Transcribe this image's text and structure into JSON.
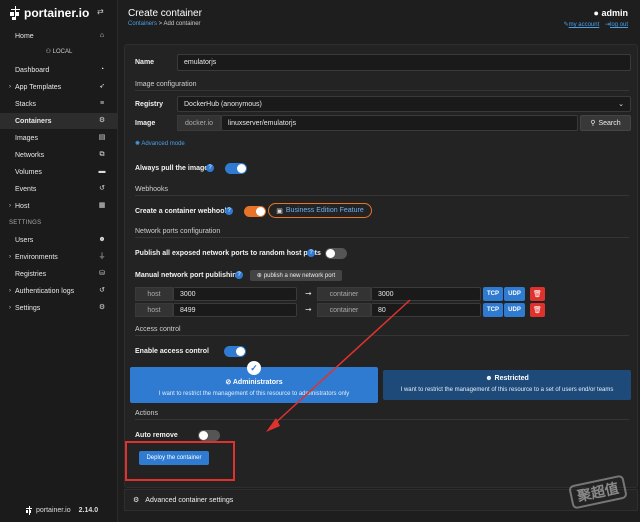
{
  "sidebar": {
    "brand": "portainer.io",
    "items": [
      {
        "label": "Home",
        "icon": "home-icon"
      },
      {
        "label": "Dashboard",
        "icon": "dashboard-icon"
      },
      {
        "label": "App Templates",
        "icon": "rocket-icon"
      },
      {
        "label": "Stacks",
        "icon": "stack-icon"
      },
      {
        "label": "Containers",
        "icon": "containers-icon"
      },
      {
        "label": "Images",
        "icon": "images-icon"
      },
      {
        "label": "Networks",
        "icon": "network-icon"
      },
      {
        "label": "Volumes",
        "icon": "volume-icon"
      },
      {
        "label": "Events",
        "icon": "history-icon"
      },
      {
        "label": "Host",
        "icon": "grid-icon"
      },
      {
        "label": "Users",
        "icon": "users-icon"
      },
      {
        "label": "Environments",
        "icon": "plug-icon"
      },
      {
        "label": "Registries",
        "icon": "database-icon"
      },
      {
        "label": "Authentication logs",
        "icon": "history-icon"
      },
      {
        "label": "Settings",
        "icon": "cogs-icon"
      }
    ],
    "env_label": "LOCAL",
    "settings_heading": "SETTINGS",
    "footer_brand": "portainer.io",
    "version": "2.14.0"
  },
  "header": {
    "title": "Create container",
    "breadcrumb_link": "Containers",
    "breadcrumb_sep": " > ",
    "breadcrumb_current": "Add container",
    "user": "admin",
    "my_account": "my account",
    "log_out": "log out"
  },
  "form": {
    "name_label": "Name",
    "name_value": "emulatorjs",
    "image_section": "Image configuration",
    "registry_label": "Registry",
    "registry_value": "DockerHub (anonymous)",
    "image_label": "Image",
    "image_prefix": "docker.io",
    "image_value": "linuxserver/emulatorjs",
    "search_button": "Search",
    "advanced_mode": "Advanced mode",
    "always_pull_label": "Always pull the image",
    "webhooks_section": "Webhooks",
    "webhook_label": "Create a container webhook",
    "business_feature": "Business Edition Feature",
    "ports_section": "Network ports configuration",
    "publish_all_label": "Publish all exposed network ports to random host ports",
    "manual_label": "Manual network port publishing",
    "publish_new_button": "publish a new network port",
    "ports": [
      {
        "host_label": "host",
        "host": "3000",
        "container_label": "container",
        "container": "3000",
        "tcp": "TCP",
        "udp": "UDP"
      },
      {
        "host_label": "host",
        "host": "8499",
        "container_label": "container",
        "container": "80",
        "tcp": "TCP",
        "udp": "UDP"
      }
    ],
    "access_section": "Access control",
    "enable_access_label": "Enable access control",
    "admin_title": "Administrators",
    "admin_desc": "I want to restrict the management of this resource to administrators only",
    "restricted_title": "Restricted",
    "restricted_desc": "I want to restrict the management of this resource to a set of users end/or teams",
    "actions_section": "Actions",
    "auto_remove_label": "Auto remove",
    "deploy_button": "Deploy the container",
    "advanced_settings": "Advanced container settings"
  },
  "watermark": "聚超值",
  "colors": {
    "accent": "#2f7bd1",
    "toggle_orange": "#e8742a",
    "danger": "#e0322d",
    "restricted_bg": "#1e4a7a"
  }
}
